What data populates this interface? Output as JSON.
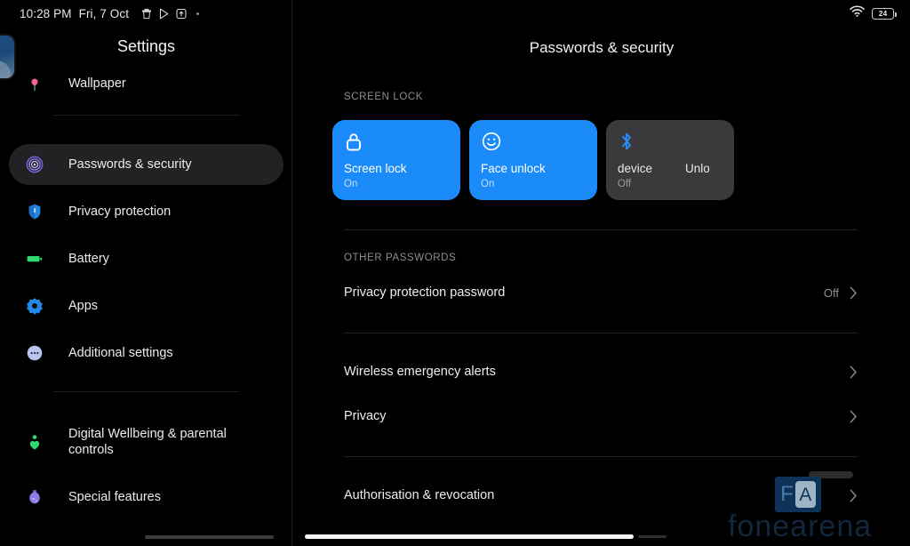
{
  "status_bar": {
    "time": "10:28 PM",
    "date": "Fri, 7 Oct",
    "icons": [
      "trash-icon",
      "play-store-icon",
      "upload-box-icon",
      "overflow-dot"
    ],
    "wifi_icon": "wifi-icon",
    "battery_percent": "24"
  },
  "sidebar": {
    "title": "Settings",
    "items": [
      {
        "label": "Wallpaper",
        "icon": "tulip-icon",
        "active": false
      },
      {
        "label": "Passwords & security",
        "icon": "fingerprint-icon",
        "active": true
      },
      {
        "label": "Privacy protection",
        "icon": "shield-icon",
        "active": false
      },
      {
        "label": "Battery",
        "icon": "battery-icon",
        "active": false
      },
      {
        "label": "Apps",
        "icon": "apps-gear-icon",
        "active": false
      },
      {
        "label": "Additional settings",
        "icon": "more-dots-icon",
        "active": false
      },
      {
        "label": "Digital Wellbeing & parental controls",
        "icon": "wellbeing-icon",
        "active": false
      },
      {
        "label": "Special features",
        "icon": "special-features-icon",
        "active": false
      }
    ]
  },
  "main": {
    "title": "Passwords & security",
    "screen_lock_label": "SCREEN LOCK",
    "cards": [
      {
        "title": "Screen lock",
        "status": "On",
        "icon": "lock-icon",
        "style": "blue"
      },
      {
        "title": "Face unlock",
        "status": "On",
        "icon": "smiley-face-icon",
        "style": "blue"
      },
      {
        "title": "device",
        "title_extra": "Unlo",
        "status": "Off",
        "icon": "bluetooth-icon",
        "style": "gray"
      }
    ],
    "other_passwords_label": "OTHER PASSWORDS",
    "rows": [
      {
        "label": "Privacy protection password",
        "value": "Off"
      },
      {
        "label": "Wireless emergency alerts",
        "value": ""
      },
      {
        "label": "Privacy",
        "value": ""
      },
      {
        "label": "Authorisation & revocation",
        "value": ""
      }
    ]
  },
  "watermark": {
    "logo_f": "F",
    "logo_a": "A",
    "text": "fonearena"
  },
  "colors": {
    "accent_blue": "#1b8bf9",
    "card_gray": "#3a3a3c",
    "background": "#000000",
    "active_item": "#222225"
  }
}
